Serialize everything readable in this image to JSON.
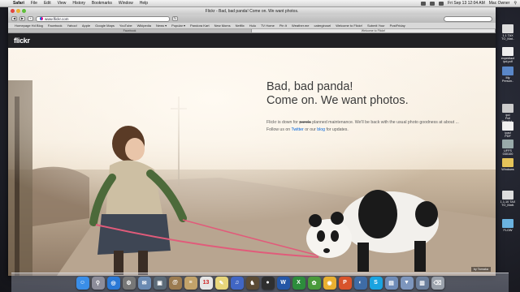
{
  "menubar": {
    "app": "Safari",
    "items": [
      "File",
      "Edit",
      "View",
      "History",
      "Bookmarks",
      "Window",
      "Help"
    ],
    "clock": "Fri Sep 13  12:04 AM",
    "user": "Mac Owner"
  },
  "window": {
    "title": "Flickr - Bad, bad panda! Come on. We want photos.",
    "url": "www.flickr.com"
  },
  "bookmarks": [
    "Homepage Hd Blog",
    "Facebook",
    "Yahoo!",
    "Apple",
    "Google Maps",
    "YouTube",
    "Wikipedia",
    "News ▾",
    "Popular ▾",
    "Pandora Kart",
    "New Moms",
    "Netflix",
    "Hulu",
    "TV Home",
    "Pin It",
    "Weather.me",
    "catergirosel",
    "Welcome to Flickr!",
    "Submit Your",
    "PostFriday"
  ],
  "tabs": [
    "Facebook",
    "Welcome to Flickr!"
  ],
  "flickr": {
    "logo": "flickr",
    "headline_1": "Bad, bad panda!",
    "headline_2": "Come on. We want photos.",
    "body_1a": "Flickr is down for ",
    "body_1b": "panda",
    "body_1c": " planned maintenance. We'll be back with the usual photo goodness at about ...",
    "body_2a": "Follow us on ",
    "twitter_link": "Twitter",
    "body_2b": " or our ",
    "blog_link": "blog",
    "body_2c": " for updates.",
    "credit": "by Tamaka"
  },
  "desktop_icons": [
    "1.1 TAX\nTO_Mat..",
    "expediact\nipd.pdf",
    "My\nPerson..",
    "ipd\nFull\nResolut..",
    "ipad\nPDF",
    "UFFS\n030100",
    "Windows",
    "1.1.10 TAX\nTO_Matt.",
    "FLOW"
  ],
  "dock": {
    "items": [
      {
        "icon": "finder-icon",
        "color": "#3a8ee8",
        "glyph": "☺"
      },
      {
        "icon": "launchpad-icon",
        "color": "#8d8d9a",
        "glyph": "⚲"
      },
      {
        "icon": "safari-icon",
        "color": "#2b79d6",
        "glyph": "◎"
      },
      {
        "icon": "system-prefs-icon",
        "color": "#777",
        "glyph": "⚙"
      },
      {
        "icon": "mail-icon",
        "color": "#6a8ab2",
        "glyph": "✉"
      },
      {
        "icon": "photos-icon",
        "color": "#5c6b79",
        "glyph": "▣"
      },
      {
        "icon": "contacts-icon",
        "color": "#9b7b50",
        "glyph": "@"
      },
      {
        "icon": "address-icon",
        "color": "#c2a36a",
        "glyph": "≡"
      },
      {
        "icon": "calendar-icon",
        "color": "#e6e6e6",
        "glyph": "13"
      },
      {
        "icon": "notes-icon",
        "color": "#e8d67b",
        "glyph": "✎"
      },
      {
        "icon": "itunes-icon",
        "color": "#4166c4",
        "glyph": "♫"
      },
      {
        "icon": "chess-icon",
        "color": "#5b4b35",
        "glyph": "♞"
      },
      {
        "icon": "facetime-icon",
        "color": "#2f2f2f",
        "glyph": "●"
      },
      {
        "icon": "word-icon",
        "color": "#2456a6",
        "glyph": "W"
      },
      {
        "icon": "excel-icon",
        "color": "#2d8c3c",
        "glyph": "X"
      },
      {
        "icon": "messenger-icon",
        "color": "#4a9a3b",
        "glyph": "✿"
      },
      {
        "icon": "outlook-icon",
        "color": "#e9b030",
        "glyph": "◉"
      },
      {
        "icon": "powerpoint-icon",
        "color": "#d8532b",
        "glyph": "P"
      },
      {
        "icon": "remote-icon",
        "color": "#3e6ca6",
        "glyph": "◐"
      },
      {
        "icon": "skype-icon",
        "color": "#1aa3e0",
        "glyph": "S"
      },
      {
        "icon": "folder-icon",
        "color": "#6f8cb8",
        "glyph": "▤"
      },
      {
        "icon": "downloads-icon",
        "color": "#7d96bd",
        "glyph": "▼"
      },
      {
        "icon": "documents-icon",
        "color": "#6b7f9c",
        "glyph": "▥"
      },
      {
        "icon": "trash-icon",
        "color": "#9aa1ab",
        "glyph": "⌫"
      }
    ]
  },
  "colors": {
    "flickr_blue": "#0063dc",
    "flickr_pink": "#ff0084",
    "header_bg": "#212124"
  }
}
